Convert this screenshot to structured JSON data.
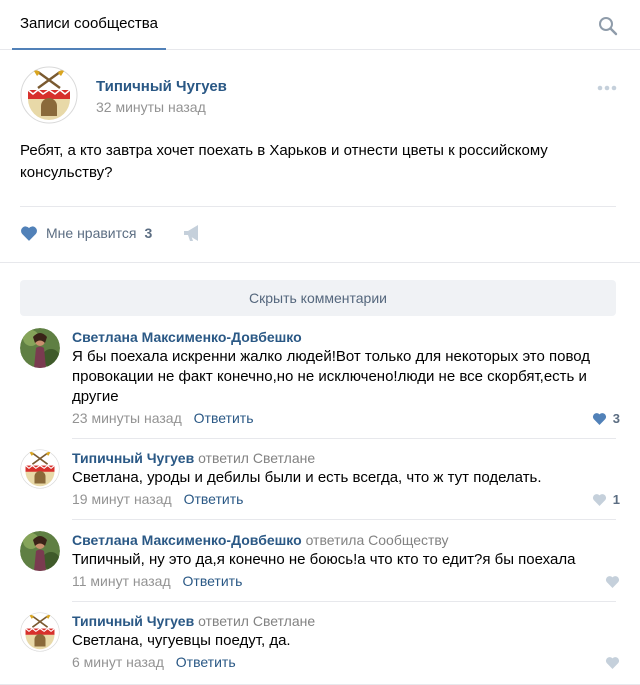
{
  "header": {
    "tab_label": "Записи сообщества",
    "search_icon": "search-icon"
  },
  "post": {
    "author": "Типичный Чугуев",
    "time": "32 минуты назад",
    "text": "Ребят, а кто завтра хочет поехать в Харьков и отнести цветы к российскому консульству?",
    "like_label": "Мне нравится",
    "like_count": "3",
    "more_icon": "more-dots-icon",
    "share_icon": "megaphone-icon"
  },
  "hide_comments_label": "Скрыть комментарии",
  "comments": [
    {
      "author": "Светлана Максименко-Довбешко",
      "reply_to": "",
      "text": "Я бы поехала искренни жалко людей!Вот только для некоторых это повод провокации не факт конечно,но не исключено!люди не все скорбят,есть и другие",
      "time": "23 минуты назад",
      "reply_label": "Ответить",
      "likes": "3"
    },
    {
      "author": "Типичный Чугуев",
      "reply_to": "ответил Светлане",
      "text": "Светлана, уроды и дебилы были и есть всегда, что ж тут поделать.",
      "time": "19 минут назад",
      "reply_label": "Ответить",
      "likes": "1"
    },
    {
      "author": "Светлана Максименко-Довбешко",
      "reply_to": "ответила Сообществу",
      "text": "Типичный, ну это да,я конечно не боюсь!а что кто то едит?я бы поехала",
      "time": "11 минут назад",
      "reply_label": "Ответить",
      "likes": ""
    },
    {
      "author": "Типичный Чугуев",
      "reply_to": "ответил Светлане",
      "text": "Светлана, чугуевцы поедут, да.",
      "time": "6 минут назад",
      "reply_label": "Ответить",
      "likes": ""
    }
  ],
  "colors": {
    "link": "#2a5885",
    "accent": "#5181b8",
    "muted": "#939393",
    "like_active": "#5181b8",
    "like_inactive": "#c5d0db"
  }
}
